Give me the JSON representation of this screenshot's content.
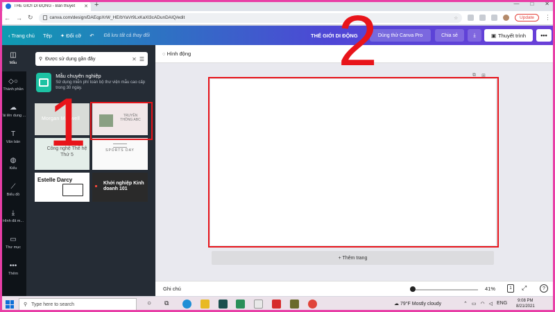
{
  "browser": {
    "tab_title": "THẾ GIỚI DI ĐỘNG - Bản thuyết",
    "new_tab": "+",
    "url": "canva.com/design/DAEqpXrW_HE/bYaVr9LxKaXl3cADunDAIQ/edit",
    "update_label": "Update",
    "window_controls": [
      "—",
      "□",
      "✕"
    ]
  },
  "header": {
    "home": "Trang chủ",
    "file": "Tệp",
    "resize": "Đổi cỡ",
    "saved": "Đã lưu tất cả thay đổi",
    "doc_title": "THẾ GIỚI DI ĐỘNG",
    "try_pro": "Dùng thử Canva Pro",
    "share": "Chia sẻ",
    "present": "Thuyết trình",
    "more": "•••"
  },
  "rail": {
    "items": [
      {
        "label": "Mẫu",
        "icon": "layout-icon"
      },
      {
        "label": "Thành phần",
        "icon": "shapes-icon"
      },
      {
        "label": "Tải lên dung ...",
        "icon": "upload-cloud-icon"
      },
      {
        "label": "Văn bản",
        "icon": "text-icon"
      },
      {
        "label": "Kiểu",
        "icon": "palette-icon"
      },
      {
        "label": "Biểu đồ",
        "icon": "chart-icon"
      },
      {
        "label": "Hình đã m...",
        "icon": "download-icon"
      },
      {
        "label": "Thư mục",
        "icon": "folder-icon"
      },
      {
        "label": "Thêm",
        "icon": "more-dots-icon"
      }
    ]
  },
  "panel": {
    "search_placeholder": "Được sử dụng gần đây",
    "promo_title": "Mẫu chuyên nghiệp",
    "promo_desc": "Sử dụng miễn phí toàn bộ thư viện mẫu cao cấp trong 30 ngày.",
    "templates": [
      {
        "text": "Morgan Maxwell"
      },
      {
        "text": "TRUYỀN THÔNG ABC"
      },
      {
        "text": "Công nghệ Thế hệ Thứ 5"
      },
      {
        "text": "SPORTS DAY"
      },
      {
        "text": "Estelle Darcy"
      },
      {
        "text": "Khởi nghiệp Kinh doanh 101"
      }
    ]
  },
  "editor": {
    "animation": "Hình động",
    "add_page": "+ Thêm trang"
  },
  "footer": {
    "notes": "Ghi chú",
    "zoom": "41%",
    "page_count": "1"
  },
  "annotations": {
    "one": "1",
    "two": "2"
  },
  "taskbar": {
    "search_placeholder": "Type here to search",
    "weather": "79°F  Mostly cloudy",
    "lang": "ENG",
    "time": "9:08 PM",
    "date": "8/21/2021"
  },
  "colors": {
    "accent": "#e8141a",
    "frame": "#e83ea6",
    "header_start": "#0e9cb1",
    "header_end": "#6b3fd8"
  }
}
